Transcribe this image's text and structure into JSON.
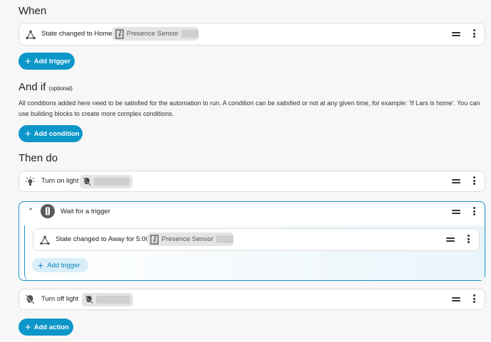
{
  "when": {
    "title": "When",
    "trigger": {
      "label": "State changed to Home",
      "entity": "Presence Sensor"
    },
    "add_button": "Add trigger"
  },
  "and_if": {
    "title": "And if",
    "optional": "(optional)",
    "description": "All conditions added here need to be satisfied for the automation to run. A condition can be satisfied or not at any given time, for example: 'If Lars is home'. You can use building blocks to create more complex conditions.",
    "add_button": "Add condition"
  },
  "then_do": {
    "title": "Then do",
    "action1": {
      "label": "Turn on light"
    },
    "wait": {
      "label": "Wait for a trigger",
      "trigger": {
        "label": "State changed to Away for 5:00",
        "entity": "Presence Sensor"
      },
      "add_button": "Add trigger"
    },
    "action3": {
      "label": "Turn off light"
    },
    "add_button": "Add action"
  },
  "colors": {
    "accent": "#0d96c9",
    "accent_light": "#d9eef8",
    "wait_bg": "#eef6fb"
  }
}
